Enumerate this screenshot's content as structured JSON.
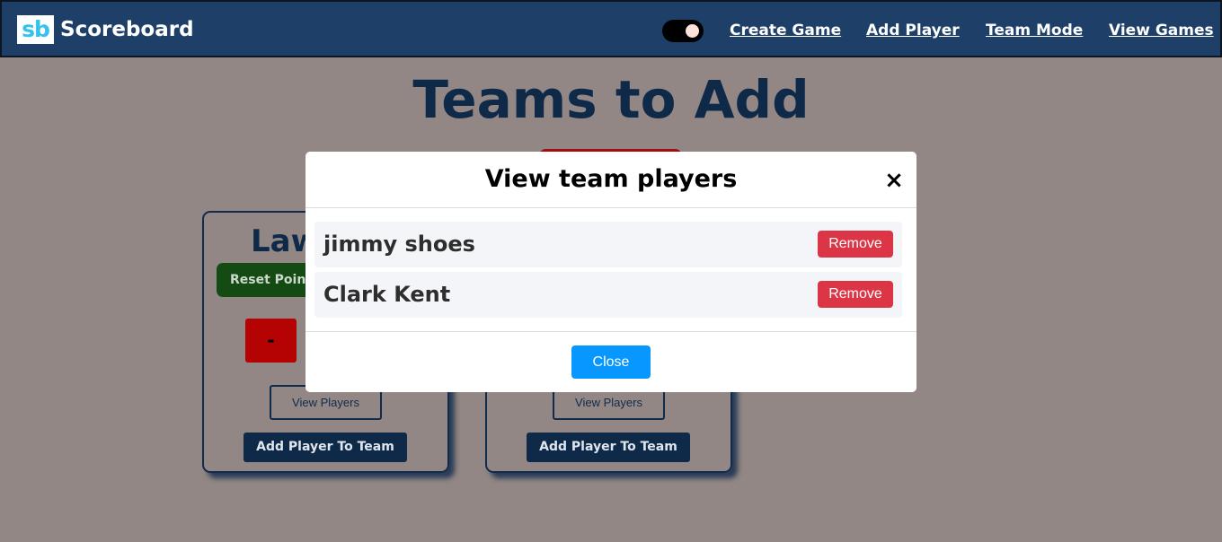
{
  "navbar": {
    "logo_text": "sb",
    "brand": "Scoreboard",
    "toggle_state": "on",
    "links": [
      "Create Game",
      "Add Player",
      "Team Mode",
      "View Games"
    ]
  },
  "page": {
    "title": "Teams to Add"
  },
  "teams": [
    {
      "name_visible": "Law",
      "reset_label": "Reset Points",
      "minus_label": "-",
      "view_players_label": "View Players",
      "add_player_label": "Add Player To Team"
    },
    {
      "view_players_label": "View Players",
      "add_player_label": "Add Player To Team"
    }
  ],
  "modal": {
    "title": "View team players",
    "close_icon": "×",
    "players": [
      {
        "name": "jimmy shoes",
        "remove_label": "Remove"
      },
      {
        "name": "Clark Kent",
        "remove_label": "Remove"
      }
    ],
    "close_label": "Close"
  },
  "colors": {
    "navbar": "#1e4068",
    "page_background": "#928784",
    "accent_dark": "#0f2a48",
    "remove": "#dc3545",
    "close": "#0897ff",
    "reset": "#134b12",
    "minus": "#b50202"
  }
}
